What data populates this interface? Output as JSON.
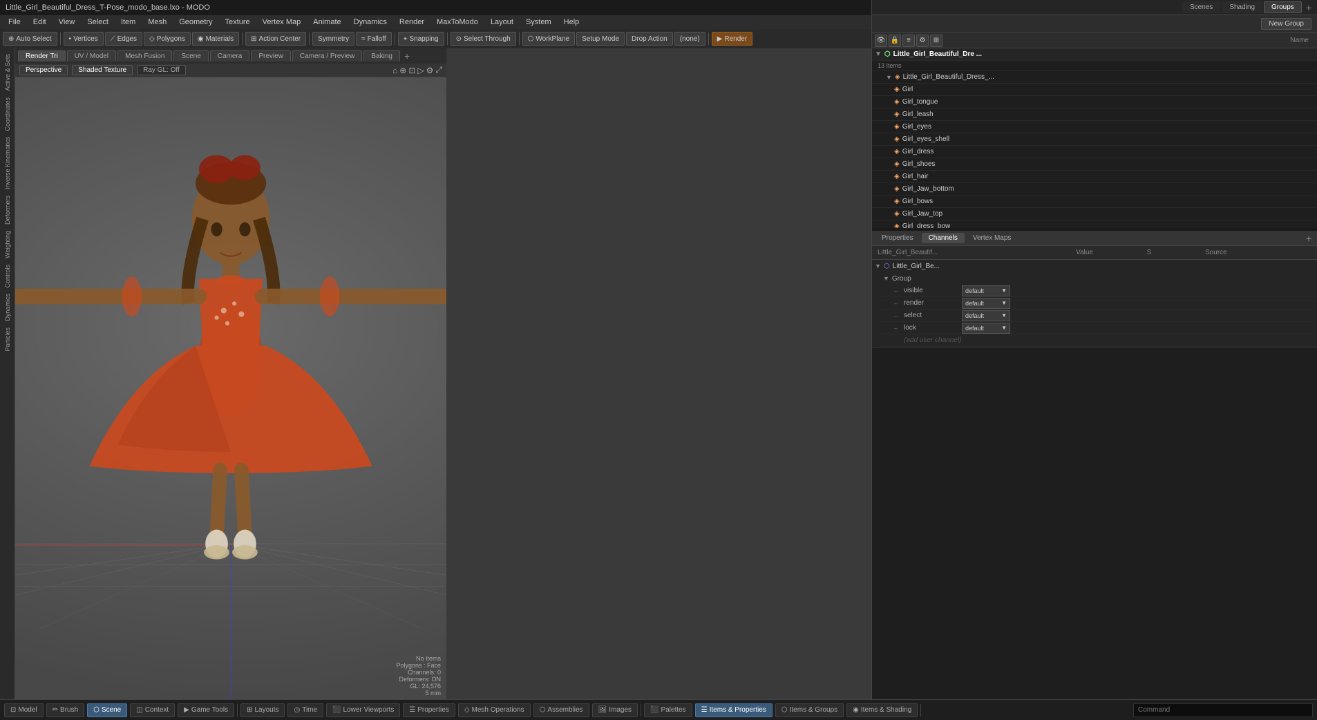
{
  "titlebar": {
    "title": "Little_Girl_Beautiful_Dress_T-Pose_modo_base.lxo - MODO"
  },
  "menubar": {
    "items": [
      "File",
      "Edit",
      "View",
      "Select",
      "Item",
      "Mesh",
      "Geometry",
      "Texture",
      "Vertex Map",
      "Animate",
      "Dynamics",
      "Render",
      "MaxToModo",
      "Layout",
      "System",
      "Help"
    ]
  },
  "toolbar": {
    "auto_select": "Auto Select",
    "vertices": "Vertices",
    "edges": "Edges",
    "polygons": "Polygons",
    "materials": "Materials",
    "action_center": "Action Center",
    "symmetry": "Symmetry",
    "falloff": "Falloff",
    "snapping": "Snapping",
    "select_through": "Select Through",
    "workplane": "WorkPlane",
    "setup_mode": "Setup Mode",
    "drop_action": "Drop Action",
    "none_label": "(none)",
    "render": "Render"
  },
  "viewport_tabs": {
    "tabs": [
      "Render Tri",
      "UV / Model",
      "Mesh Fusion",
      "Scene",
      "Camera",
      "Preview",
      "Camera / Preview",
      "Baking"
    ],
    "active": "Render Tri",
    "add_icon": "+"
  },
  "viewport_subtoolbar": {
    "perspective": "Perspective",
    "shaded_texture": "Shaded Texture",
    "ray_gl": "Ray GL: Off"
  },
  "left_sidebar": {
    "tabs": [
      "Active & Sets",
      "Coordinates",
      "Inverse Kinematics",
      "Deformers",
      "Weighting",
      "Controls",
      "Dynamics",
      "Particles"
    ]
  },
  "right_panel_tabs": {
    "tabs": [
      "Scenes",
      "Shading",
      "Groups"
    ],
    "active": "Groups",
    "add_icon": "+"
  },
  "new_group_btn": "New Group",
  "items_panel": {
    "header_label": "Name",
    "toolbar_icons": [
      "eye",
      "lock",
      "filter",
      "gear",
      "columns"
    ],
    "count_label": "13 Items",
    "group_name": "Little_Girl_Beautiful_Dre ...",
    "items": [
      {
        "name": "Little_Girl_Beautiful_Dress_...",
        "type": "group",
        "indent": 1
      },
      {
        "name": "Girl",
        "type": "mesh",
        "indent": 2
      },
      {
        "name": "Girl_tongue",
        "type": "mesh",
        "indent": 2
      },
      {
        "name": "Girl_leash",
        "type": "mesh",
        "indent": 2
      },
      {
        "name": "Girl_eyes",
        "type": "mesh",
        "indent": 2
      },
      {
        "name": "Girl_eyes_shell",
        "type": "mesh",
        "indent": 2
      },
      {
        "name": "Girl_dress",
        "type": "mesh",
        "indent": 2
      },
      {
        "name": "Girl_shoes",
        "type": "mesh",
        "indent": 2
      },
      {
        "name": "Girl_hair",
        "type": "mesh",
        "indent": 2
      },
      {
        "name": "Girl_Jaw_bottom",
        "type": "mesh",
        "indent": 2
      },
      {
        "name": "Girl_bows",
        "type": "mesh",
        "indent": 2
      },
      {
        "name": "Girl_Jaw_top",
        "type": "mesh",
        "indent": 2
      },
      {
        "name": "Girl_dress_bow",
        "type": "mesh",
        "indent": 2
      }
    ]
  },
  "properties_panel": {
    "tabs": [
      "Properties",
      "Channels",
      "Vertex Maps"
    ],
    "active_tab": "Channels",
    "add_btn": "+",
    "header": {
      "name_col": "Little_Girl_Beautif...",
      "value_col": "Value",
      "s_col": "S",
      "source_col": "Source"
    },
    "tree": {
      "group_name": "Little_Girl_Be...",
      "sub_group": "Group",
      "rows": [
        {
          "label": "visible",
          "value": "default",
          "has_dropdown": true
        },
        {
          "label": "render",
          "value": "default",
          "has_dropdown": true
        },
        {
          "label": "select",
          "value": "default",
          "has_dropdown": true
        },
        {
          "label": "lock",
          "value": "default",
          "has_dropdown": true
        }
      ],
      "add_user_channel": "(add user channel)"
    }
  },
  "viewport_info": {
    "no_items": "No Items",
    "polygons_face": "Polygons : Face",
    "channels": "Channels: 0",
    "deformers": "Deformers: ON",
    "gl": "GL: 24,576",
    "mm": "5 mm"
  },
  "status_bar": {
    "model": "Model",
    "brush": "Brush",
    "scene": "Scene",
    "context": "Context",
    "game_tools": "Game Tools",
    "layouts": "Layouts",
    "time": "Time",
    "lower_viewports": "Lower Viewports",
    "properties": "Properties",
    "mesh_operations": "Mesh Operations",
    "assemblies": "Assemblies",
    "images": "Images",
    "palettes": "Palettes",
    "items_properties": "Items & Properties",
    "items_groups": "Items & Groups",
    "items_shading": "Items & Shading",
    "command_placeholder": "Command"
  },
  "colors": {
    "accent_blue": "#3a6a9a",
    "toolbar_bg": "#2a2a2a",
    "viewport_bg": "#606060",
    "panel_bg": "#2d2d2d",
    "selected_bg": "#1e3a5a",
    "active_tab": "#4a4a4a",
    "orange_accent": "#c86a20"
  }
}
